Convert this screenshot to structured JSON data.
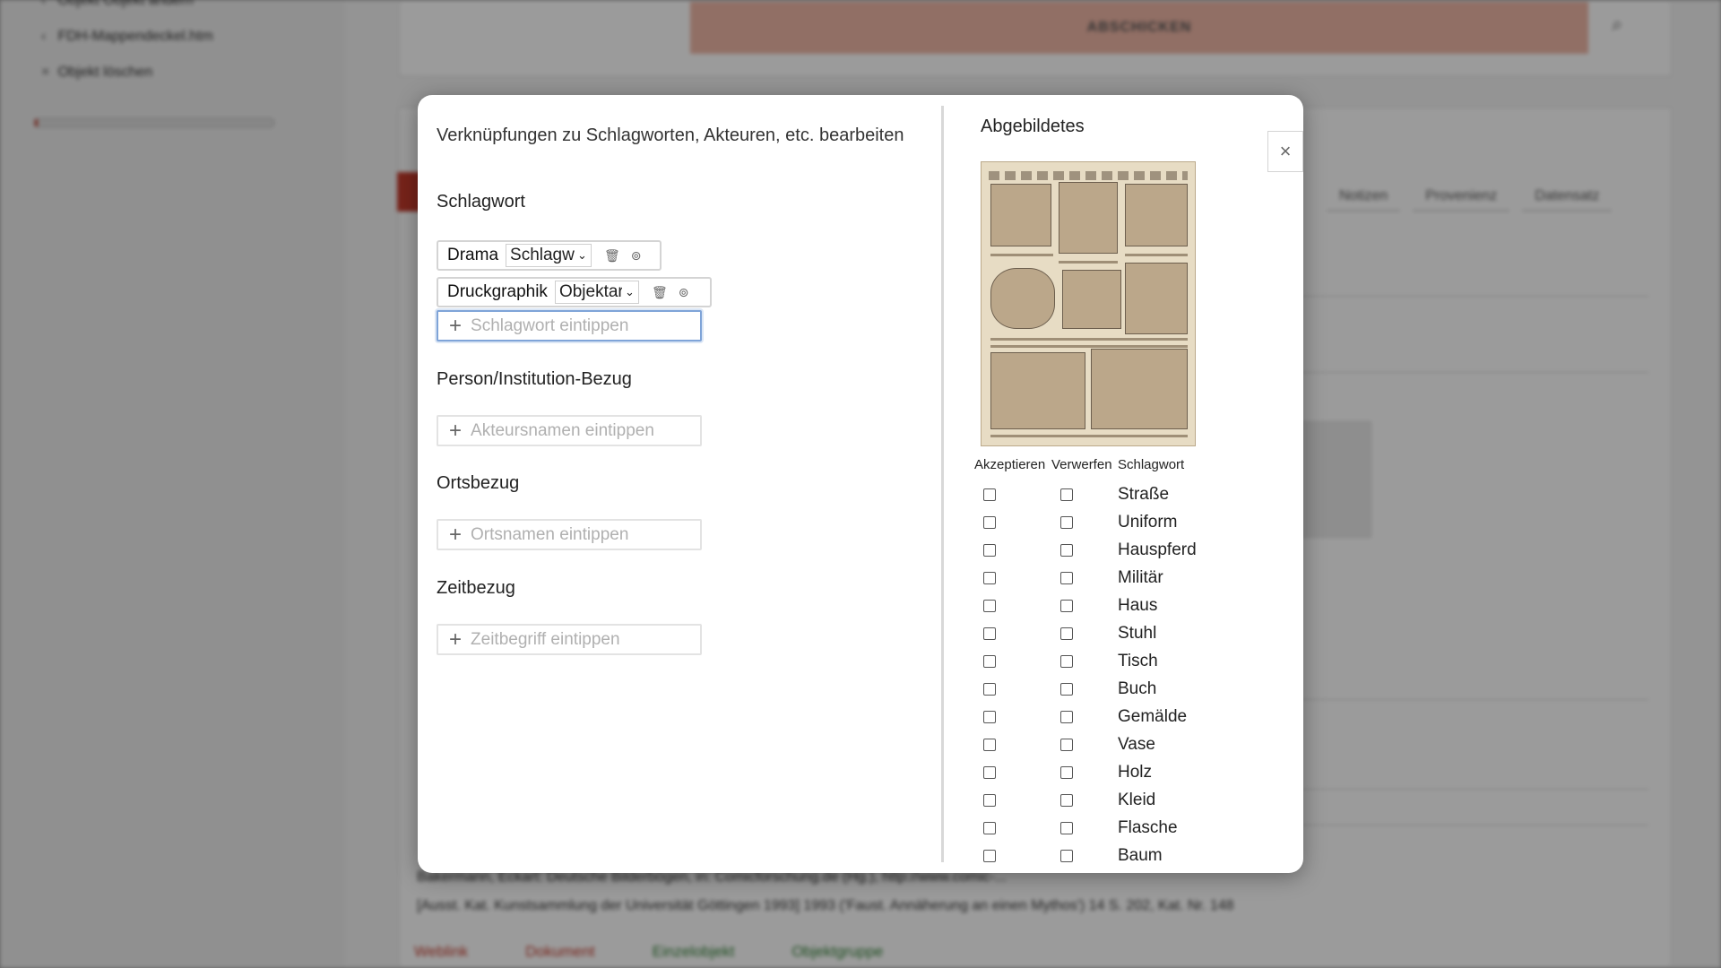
{
  "background": {
    "nav_items": [
      {
        "mark": "‹",
        "label": "Objekt Objekt ändern"
      },
      {
        "mark": "‹",
        "label": "FDH-Mappendeckel.htm"
      },
      {
        "mark": "×",
        "label": "Objekt löschen"
      }
    ],
    "progress_fraction": 0.01,
    "submit_label": "ABSCHICKEN",
    "tabs": [
      "Notizen",
      "Provenienz",
      "Datensatz"
    ],
    "references": [
      "Bakermann, Eckart: Deutsche Bilderbögen, in: Comicforschung.de (Hg.), http://www.comic-...",
      "[Ausst. Kat. Kunstsammlung der Universität Göttingen 1993] 1993 ('Faust. Annäherung an einen Mythos') 14 S. 202, Kat. Nr. 148"
    ],
    "links": [
      "Weblink",
      "Dokument",
      "Einzelobjekt",
      "Objektgruppe"
    ],
    "colors": {
      "submit": "#eab3a3",
      "accent_red": "#c0392b",
      "link_green": "#2e7d32"
    }
  },
  "modal": {
    "title": "Verknüpfungen zu Schlagworten, Akteuren, etc. bearbeiten",
    "sections": {
      "schlagwort": {
        "title": "Schlagwort",
        "tags": [
          {
            "name": "Drama",
            "type": "Schlagwort"
          },
          {
            "name": "Druckgraphik",
            "type": "Objektart"
          }
        ],
        "input_placeholder": "Schlagwort eintippen"
      },
      "person": {
        "title": "Person/Institution-Bezug",
        "input_placeholder": "Akteursnamen eintippen"
      },
      "ort": {
        "title": "Ortsbezug",
        "input_placeholder": "Ortsnamen eintippen"
      },
      "zeit": {
        "title": "Zeitbezug",
        "input_placeholder": "Zeitbegriff eintippen"
      }
    },
    "right": {
      "title": "Abgebildetes",
      "headers": {
        "accept": "Akzeptieren",
        "reject": "Verwerfen",
        "keyword": "Schlagwort"
      },
      "keywords": [
        "Straße",
        "Uniform",
        "Hauspferd",
        "Militär",
        "Haus",
        "Stuhl",
        "Tisch",
        "Buch",
        "Gemälde",
        "Vase",
        "Holz",
        "Kleid",
        "Flasche",
        "Baum"
      ]
    },
    "close_symbol": "×",
    "icons": {
      "delete": "trash-icon",
      "plus": "plus-icon",
      "chevron": "chevron-down-icon",
      "info": "circle-arrow-icon"
    }
  }
}
